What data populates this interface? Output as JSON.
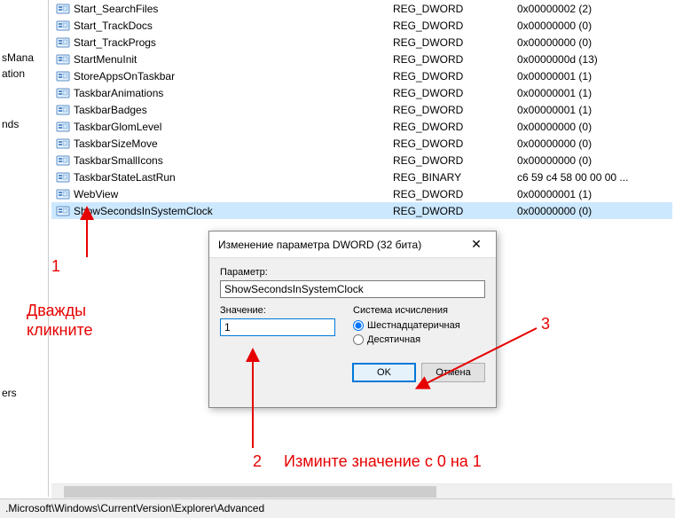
{
  "sidebar": {
    "partial1": "sMana",
    "partial2": "ation",
    "partial3": "nds",
    "partial4": "ers"
  },
  "registry": {
    "rows": [
      {
        "name": "Start_SearchFiles",
        "type": "REG_DWORD",
        "data": "0x00000002 (2)"
      },
      {
        "name": "Start_TrackDocs",
        "type": "REG_DWORD",
        "data": "0x00000000 (0)"
      },
      {
        "name": "Start_TrackProgs",
        "type": "REG_DWORD",
        "data": "0x00000000 (0)"
      },
      {
        "name": "StartMenuInit",
        "type": "REG_DWORD",
        "data": "0x0000000d (13)"
      },
      {
        "name": "StoreAppsOnTaskbar",
        "type": "REG_DWORD",
        "data": "0x00000001 (1)"
      },
      {
        "name": "TaskbarAnimations",
        "type": "REG_DWORD",
        "data": "0x00000001 (1)"
      },
      {
        "name": "TaskbarBadges",
        "type": "REG_DWORD",
        "data": "0x00000001 (1)"
      },
      {
        "name": "TaskbarGlomLevel",
        "type": "REG_DWORD",
        "data": "0x00000000 (0)"
      },
      {
        "name": "TaskbarSizeMove",
        "type": "REG_DWORD",
        "data": "0x00000000 (0)"
      },
      {
        "name": "TaskbarSmallIcons",
        "type": "REG_DWORD",
        "data": "0x00000000 (0)"
      },
      {
        "name": "TaskbarStateLastRun",
        "type": "REG_BINARY",
        "data": "c6 59 c4 58 00 00 00 ..."
      },
      {
        "name": "WebView",
        "type": "REG_DWORD",
        "data": "0x00000001 (1)"
      },
      {
        "name": "ShowSecondsInSystemClock",
        "type": "REG_DWORD",
        "data": "0x00000000 (0)",
        "selected": true
      }
    ]
  },
  "dialog": {
    "title": "Изменение параметра DWORD (32 бита)",
    "param_label": "Параметр:",
    "param_value": "ShowSecondsInSystemClock",
    "value_label": "Значение:",
    "value_value": "1",
    "radix_label": "Система исчисления",
    "radix_hex": "Шестнадцатеричная",
    "radix_dec": "Десятичная",
    "ok": "OK",
    "cancel": "Отмена"
  },
  "statusbar": ".Microsoft\\Windows\\CurrentVersion\\Explorer\\Advanced",
  "annotations": {
    "n1": "1",
    "n2": "2",
    "n3": "3",
    "dbl": "Дважды\nкликните",
    "change": "Изминте значение с 0 на 1"
  }
}
